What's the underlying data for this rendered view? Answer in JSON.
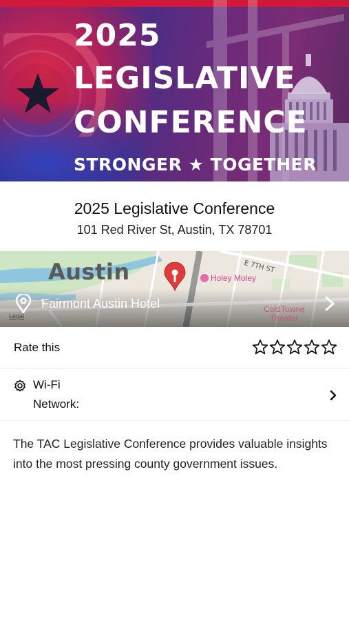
{
  "banner": {
    "line1": "2025",
    "line2": "LEGISLATIVE",
    "line3": "CONFERENCE",
    "tagline": "STRONGER ★ TOGETHER",
    "colors": {
      "top_bar": "#d0183a",
      "red": "#e22848",
      "blue": "#2c2f8c",
      "purple": "#6a2a7a"
    }
  },
  "event": {
    "title": "2025 Legislative Conference",
    "address": "101 Red River St, Austin, TX 78701"
  },
  "map": {
    "city_label": "Austin",
    "street_label": "E 7TH ST",
    "poi_1": "Holey Moley",
    "poi_2_line1": "ColdTowne",
    "poi_2_line2": "Theater",
    "venue": "Fairmont Austin Hotel",
    "legal": "Legal",
    "pin_icon": "map-pin-icon",
    "venue_icon": "location-pin-icon",
    "chevron_icon": "chevron-right-icon"
  },
  "rating": {
    "label": "Rate this",
    "stars_total": 5,
    "stars_selected": 0,
    "star_icon": "star-outline-icon"
  },
  "wifi": {
    "title": "Wi-Fi",
    "subtitle": "Network:",
    "icon": "gear-icon",
    "chevron_icon": "chevron-right-icon"
  },
  "description": "The TAC Legislative Conference provides valuable insights into the most pressing county government issues."
}
